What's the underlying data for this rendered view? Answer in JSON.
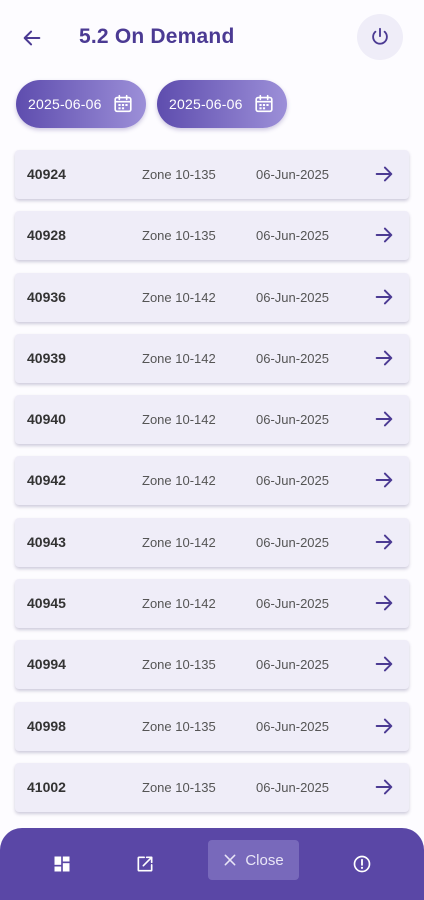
{
  "header": {
    "title": "5.2 On Demand"
  },
  "filters": {
    "from_date": "2025-06-06",
    "to_date": "2025-06-06"
  },
  "rows": [
    {
      "id": "40924",
      "zone": "Zone 10-135",
      "date": "06-Jun-2025"
    },
    {
      "id": "40928",
      "zone": "Zone 10-135",
      "date": "06-Jun-2025"
    },
    {
      "id": "40936",
      "zone": "Zone 10-142",
      "date": "06-Jun-2025"
    },
    {
      "id": "40939",
      "zone": "Zone 10-142",
      "date": "06-Jun-2025"
    },
    {
      "id": "40940",
      "zone": "Zone 10-142",
      "date": "06-Jun-2025"
    },
    {
      "id": "40942",
      "zone": "Zone 10-142",
      "date": "06-Jun-2025"
    },
    {
      "id": "40943",
      "zone": "Zone 10-142",
      "date": "06-Jun-2025"
    },
    {
      "id": "40945",
      "zone": "Zone 10-142",
      "date": "06-Jun-2025"
    },
    {
      "id": "40994",
      "zone": "Zone 10-135",
      "date": "06-Jun-2025"
    },
    {
      "id": "40998",
      "zone": "Zone 10-135",
      "date": "06-Jun-2025"
    },
    {
      "id": "41002",
      "zone": "Zone 10-135",
      "date": "06-Jun-2025"
    }
  ],
  "bottom_bar": {
    "close_label": "Close"
  },
  "icons": {
    "back": "arrow-left-icon",
    "power": "power-icon",
    "calendar": "calendar-icon",
    "row_arrow": "arrow-right-icon",
    "dashboard": "dashboard-icon",
    "edit": "edit-icon",
    "close": "close-icon",
    "info": "info-icon"
  },
  "colors": {
    "primary": "#5a47a6",
    "title": "#4b3a93",
    "row_background": "#efedf8"
  }
}
